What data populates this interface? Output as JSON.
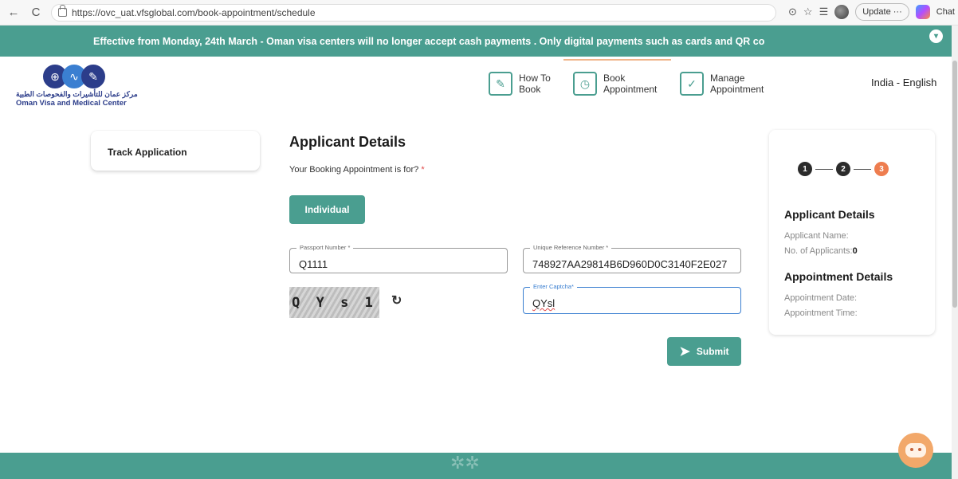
{
  "browser": {
    "back": "←",
    "reload": "C",
    "url": "https://ovc_uat.vfsglobal.com/book-appointment/schedule",
    "update_label": "Update ···",
    "chat_label": "Chat"
  },
  "banner": {
    "text": "Effective from Monday, 24th March - Oman visa centers will no longer accept cash payments . Only digital payments such as cards and QR co"
  },
  "logo": {
    "arabic": "مركز عمان للتأشيرات والفحوصات الطبية",
    "english": "Oman Visa and Medical Center"
  },
  "nav": {
    "how_to_book": "How To Book",
    "book_appointment": "Book Appointment",
    "manage_appointment": "Manage Appointment",
    "language": "India - English"
  },
  "sidebar": {
    "track_application": "Track Application"
  },
  "form": {
    "title": "Applicant Details",
    "booking_question": "Your Booking Appointment is for?",
    "required_mark": "*",
    "individual_button": "Individual",
    "passport_label": "Passport Number *",
    "passport_value": "Q1111",
    "urn_label": "Unique Reference Number *",
    "urn_value": "748927AA29814B6D960D0C3140F2E027",
    "captcha_text": "Q Y s 1",
    "captcha_label": "Enter Captcha*",
    "captcha_value": "QYsl",
    "submit_button": "Submit"
  },
  "summary": {
    "steps": [
      "1",
      "2",
      "3"
    ],
    "current_step": 3,
    "applicant_heading": "Applicant Details",
    "applicant_name_label": "Applicant Name:",
    "num_applicants_label": "No. of Applicants:",
    "num_applicants_value": "0",
    "appointment_heading": "Appointment Details",
    "appointment_date_label": "Appointment Date:",
    "appointment_time_label": "Appointment Time:"
  },
  "colors": {
    "accent": "#4a9e90",
    "step_current": "#ee7d4f",
    "focus": "#3b7fd1"
  }
}
